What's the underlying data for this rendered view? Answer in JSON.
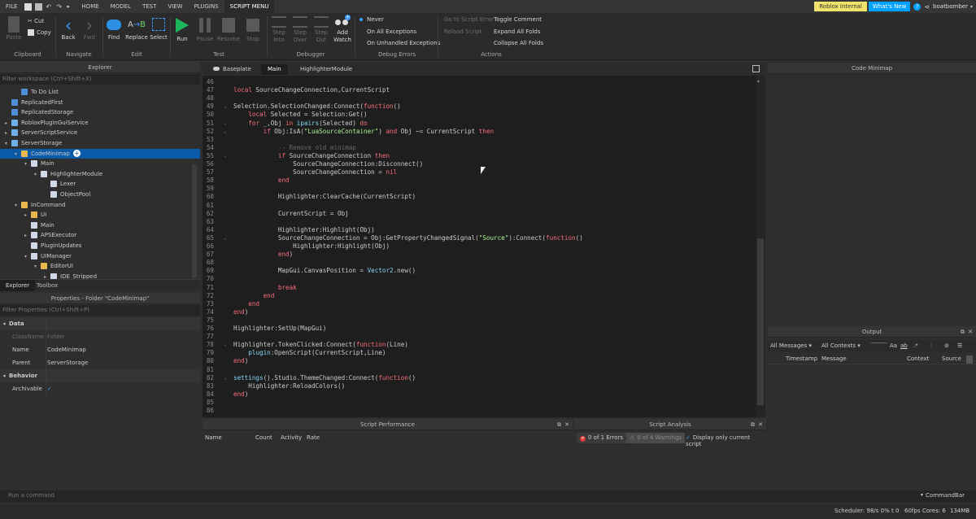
{
  "menu": {
    "tabs": [
      "FILE",
      "HOME",
      "MODEL",
      "TEST",
      "VIEW",
      "PLUGINS",
      "SCRIPT MENU"
    ],
    "active_tab": "SCRIPT MENU",
    "roblox_internal": "Roblox Internal",
    "whats_new": "What's New",
    "username": "boatbomber"
  },
  "ribbon": {
    "clipboard": {
      "cut": "Cut",
      "copy": "Copy",
      "paste": "Paste",
      "group": "Clipboard"
    },
    "navigate": {
      "back": "Back",
      "fwd": "Fwd",
      "group": "Navigate"
    },
    "edit": {
      "find": "Find",
      "replace": "Replace",
      "select": "Select",
      "group": "Edit"
    },
    "test": {
      "run": "Run",
      "pause": "Pause",
      "resume": "Resume",
      "stop": "Stop",
      "group": "Test"
    },
    "debugger": {
      "step_into": "Step Into",
      "step_over": "Step Over",
      "step_out": "Step Out",
      "add_watch": "Add Watch",
      "group": "Debugger"
    },
    "debug_errors": {
      "never": "Never",
      "on_all": "On All Exceptions",
      "on_unhandled": "On Unhandled Exceptions",
      "group": "Debug Errors"
    },
    "actions": {
      "goto_error": "Go to Script Error",
      "reload": "Reload Script",
      "toggle_comment": "Toggle Comment",
      "expand_all": "Expand All Folds",
      "collapse_all": "Collapse All Folds",
      "group": "Actions"
    }
  },
  "explorer": {
    "title": "Explorer",
    "filter": "Filter workspace (Ctrl+Shift+X)",
    "items": [
      {
        "label": "To Do List",
        "color": "#4f8fd8"
      },
      {
        "label": "ReplicatedFirst",
        "color": "#4f8fd8"
      },
      {
        "label": "ReplicatedStorage",
        "color": "#4f8fd8"
      },
      {
        "label": "RobloxPluginGuiService",
        "color": "#6fb0e8"
      },
      {
        "label": "ServerScriptService",
        "color": "#6fb0e8"
      },
      {
        "label": "ServerStorage",
        "color": "#6fb0e8"
      },
      {
        "label": "CodeMinimap",
        "color": "#e8b84f"
      },
      {
        "label": "Main",
        "color": "#cfd8e8"
      },
      {
        "label": "HighlighterModule",
        "color": "#cfd8e8"
      },
      {
        "label": "Lexer",
        "color": "#cfd8e8"
      },
      {
        "label": "ObjectPool",
        "color": "#cfd8e8"
      },
      {
        "label": "InCommand",
        "color": "#e8b84f"
      },
      {
        "label": "UI",
        "color": "#e8b84f"
      },
      {
        "label": "Main",
        "color": "#cfd8e8"
      },
      {
        "label": "APSExecutor",
        "color": "#cfd8e8"
      },
      {
        "label": "PluginUpdates",
        "color": "#cfd8e8"
      },
      {
        "label": "UIManager",
        "color": "#cfd8e8"
      },
      {
        "label": "EditorUI",
        "color": "#e8b84f"
      },
      {
        "label": "IDE_Stripped",
        "color": "#cfd8e8"
      }
    ],
    "tab_explorer": "Explorer",
    "tab_toolbox": "Toolbox"
  },
  "properties": {
    "title": "Properties - Folder \"CodeMinimap\"",
    "filter": "Filter Properties (Ctrl+Shift+P)",
    "section_data": "Data",
    "classname_label": "ClassName",
    "classname_value": "Folder",
    "name_label": "Name",
    "name_value": "CodeMinimap",
    "parent_label": "Parent",
    "parent_value": "ServerStorage",
    "section_behavior": "Behavior",
    "archivable_label": "Archivable"
  },
  "editor_tabs": [
    "Baseplate",
    "Main",
    "HighlighterModule"
  ],
  "active_editor_tab": "Main",
  "minimap_title": "Code Minimap",
  "output": {
    "title": "Output",
    "filter_messages": "All Messages",
    "filter_contexts": "All Contexts",
    "columns": [
      "Timestamp",
      "Message",
      "Context",
      "Source"
    ]
  },
  "script_performance": {
    "title": "Script Performance",
    "columns": [
      "Name",
      "Count",
      "Activity",
      "Rate"
    ]
  },
  "script_analysis": {
    "title": "Script Analysis",
    "errors": "0 of 1 Errors",
    "warnings": "0 of 4 Warnings",
    "display_only": "Display only current script"
  },
  "command_bar": {
    "placeholder": "Run a command",
    "label": "CommandBar"
  },
  "status": {
    "scheduler": "Scheduler: 98/s 0%",
    "t": "t 0",
    "fps": "60fps",
    "cores": "Cores: 6",
    "mem": "134MB"
  },
  "code_lines": [
    {
      "n": "46",
      "t": ""
    },
    {
      "n": "47",
      "t": "<span class='kw'>local</span> SourceChangeConnection,CurrentScript"
    },
    {
      "n": "48",
      "t": ""
    },
    {
      "n": "49",
      "t": "Selection.SelectionChanged:Connect(<span class='kw'>function</span>()"
    },
    {
      "n": "50",
      "t": "    <span class='kw'>local</span> Selected = Selection:Get()"
    },
    {
      "n": "51",
      "t": "    <span class='kw'>for</span> _,Obj <span class='kw'>in</span> <span class='bi'>ipairs</span>(Selected) <span class='kw'>do</span>"
    },
    {
      "n": "52",
      "t": "        <span class='kw'>if</span> Obj:IsA(<span class='str'>\"LuaSourceContainer\"</span>) <span class='kw'>and</span> Obj ~= CurrentScript <span class='kw'>then</span>"
    },
    {
      "n": "53",
      "t": ""
    },
    {
      "n": "54",
      "t": "            <span class='cm'>-- Remove old minimap</span>"
    },
    {
      "n": "55",
      "t": "            <span class='kw'>if</span> SourceChangeConnection <span class='kw'>then</span>"
    },
    {
      "n": "56",
      "t": "                SourceChangeConnection:Disconnect()"
    },
    {
      "n": "57",
      "t": "                SourceChangeConnection = <span class='kw'>nil</span>"
    },
    {
      "n": "58",
      "t": "            <span class='kw'>end</span>"
    },
    {
      "n": "59",
      "t": ""
    },
    {
      "n": "60",
      "t": "            Highlighter:ClearCache(CurrentScript)"
    },
    {
      "n": "61",
      "t": ""
    },
    {
      "n": "62",
      "t": "            CurrentScript = Obj"
    },
    {
      "n": "63",
      "t": ""
    },
    {
      "n": "64",
      "t": "            Highlighter:Highlight(Obj)"
    },
    {
      "n": "65",
      "t": "            SourceChangeConnection = Obj:GetPropertyChangedSignal(<span class='str'>\"Source\"</span>):Connect(<span class='kw'>function</span>()"
    },
    {
      "n": "66",
      "t": "                Highlighter:Highlight(Obj)"
    },
    {
      "n": "67",
      "t": "            <span class='kw'>end</span>)"
    },
    {
      "n": "68",
      "t": ""
    },
    {
      "n": "69",
      "t": "            MapGui.CanvasPosition = <span class='bi'>Vector2</span>.new()"
    },
    {
      "n": "70",
      "t": ""
    },
    {
      "n": "71",
      "t": "            <span class='kw'>break</span>"
    },
    {
      "n": "72",
      "t": "        <span class='kw'>end</span>"
    },
    {
      "n": "73",
      "t": "    <span class='kw'>end</span>"
    },
    {
      "n": "74",
      "t": "<span class='kw'>end</span>)"
    },
    {
      "n": "75",
      "t": ""
    },
    {
      "n": "76",
      "t": "Highlighter:SetUp(MapGui)"
    },
    {
      "n": "77",
      "t": ""
    },
    {
      "n": "78",
      "t": "Highlighter.TokenClicked:Connect(<span class='kw'>function</span>(Line)"
    },
    {
      "n": "79",
      "t": "    <span class='bi'>plugin</span>:OpenScript(CurrentScript,Line)"
    },
    {
      "n": "80",
      "t": "<span class='kw'>end</span>)"
    },
    {
      "n": "81",
      "t": ""
    },
    {
      "n": "82",
      "t": "<span class='bi'>settings</span>().Studio.ThemeChanged:Connect(<span class='kw'>function</span>()"
    },
    {
      "n": "83",
      "t": "    Highlighter:ReloadColors()"
    },
    {
      "n": "84",
      "t": "<span class='kw'>end</span>)"
    },
    {
      "n": "85",
      "t": ""
    },
    {
      "n": "86",
      "t": ""
    }
  ]
}
